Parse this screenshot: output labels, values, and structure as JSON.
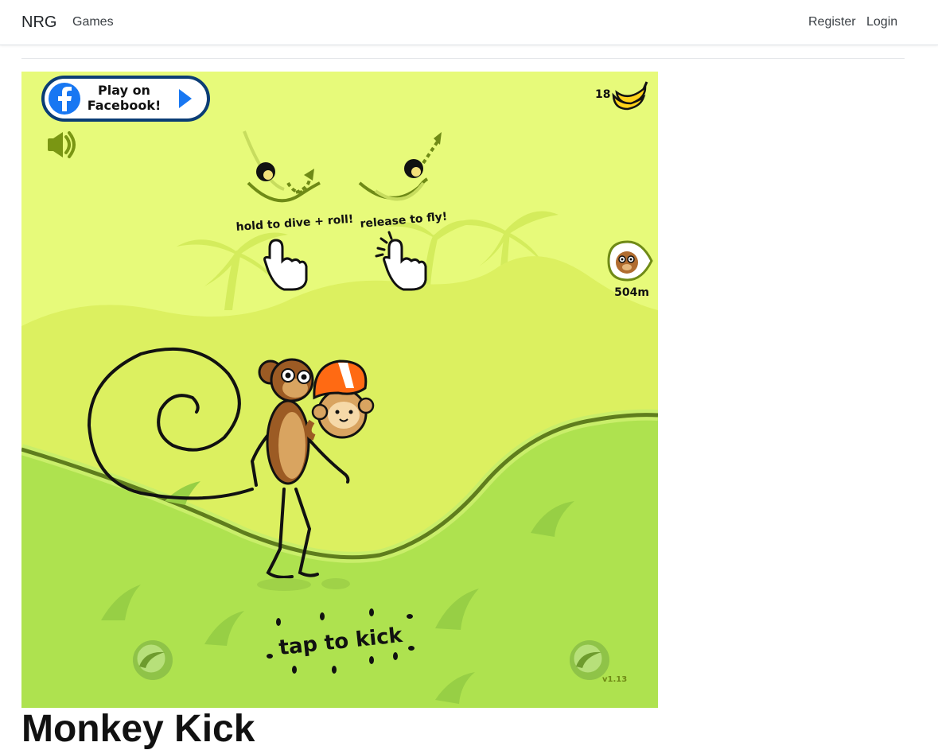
{
  "nav": {
    "brand": "NRG",
    "games": "Games",
    "register": "Register",
    "login": "Login"
  },
  "game": {
    "facebook_button": {
      "line1": "Play on",
      "line2": "Facebook!"
    },
    "banana_count": "18",
    "distance": "504m",
    "hint_dive": "hold to dive + roll!",
    "hint_fly": "release to fly!",
    "tap_to_kick": "tap to kick",
    "version": "v1.13"
  },
  "page": {
    "title": "Monkey Kick"
  },
  "colors": {
    "sky": "#e7fa7a",
    "hill_back": "#dcf060",
    "hill_front": "#aee24f",
    "facebook_blue": "#1877f2",
    "helmet_orange": "#ff6a13"
  }
}
